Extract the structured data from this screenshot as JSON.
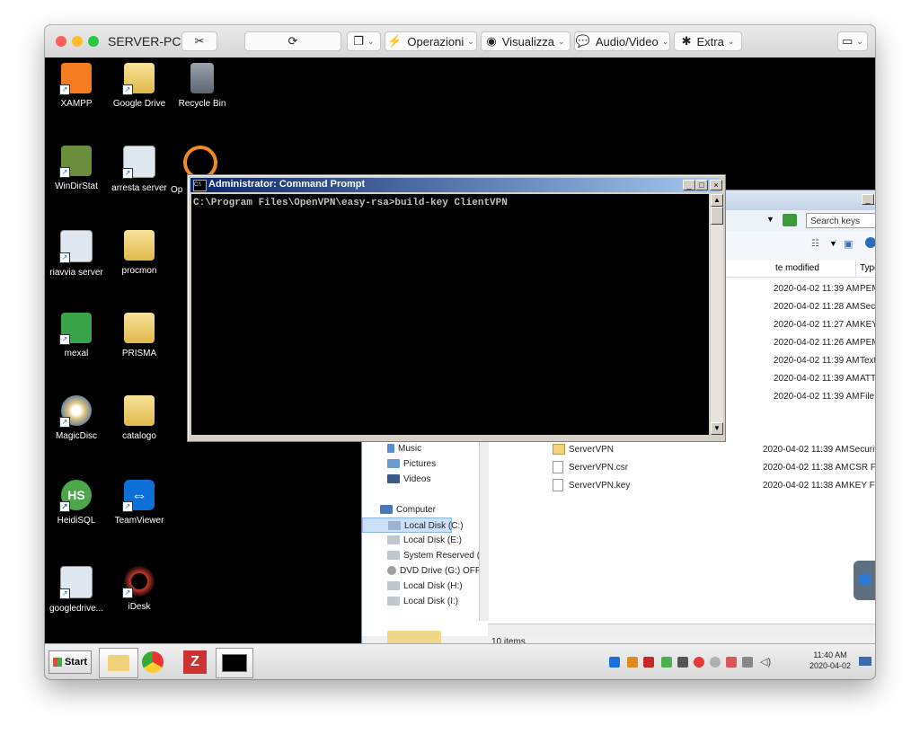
{
  "mac_window": {
    "title": "SERVER-PC",
    "toolbar": {
      "ops_label": "Operazioni",
      "view_label": "Visualizza",
      "av_label": "Audio/Video",
      "extra_label": "Extra"
    }
  },
  "desktop": {
    "icons": [
      {
        "label": "XAMPP"
      },
      {
        "label": "Google Drive"
      },
      {
        "label": "Recycle Bin"
      },
      {
        "label": "WinDirStat"
      },
      {
        "label": "arresta server"
      },
      {
        "label": "Op"
      },
      {
        "label": "riavvia server"
      },
      {
        "label": "procmon"
      },
      {
        "label": "mexal"
      },
      {
        "label": "PRISMA"
      },
      {
        "label": "MagicDisc"
      },
      {
        "label": "catalogo"
      },
      {
        "label": "HeidiSQL"
      },
      {
        "label": "TeamViewer"
      },
      {
        "label": "googledrive..."
      },
      {
        "label": "iDesk"
      }
    ]
  },
  "cmd": {
    "title": "Administrator: Command Prompt",
    "line": "C:\\Program Files\\OpenVPN\\easy-rsa>build-key ClientVPN"
  },
  "explorer": {
    "search_placeholder": "Search keys",
    "col_modified": "te modified",
    "col_type": "Type",
    "rows_hidden": [
      {
        "modified": "2020-04-02 11:39 AM",
        "type": "PEM File"
      },
      {
        "modified": "2020-04-02 11:28 AM",
        "type": "Security Certific"
      },
      {
        "modified": "2020-04-02 11:27 AM",
        "type": "KEY File"
      },
      {
        "modified": "2020-04-02 11:26 AM",
        "type": "PEM File"
      },
      {
        "modified": "2020-04-02 11:39 AM",
        "type": "Text Document"
      },
      {
        "modified": "2020-04-02 11:39 AM",
        "type": "ATTR File"
      },
      {
        "modified": "2020-04-02 11:39 AM",
        "type": "File"
      }
    ],
    "rows_visible": [
      {
        "name": "ServerVPN",
        "modified": "2020-04-02 11:39 AM",
        "type": "Security Certific"
      },
      {
        "name": "ServerVPN.csr",
        "modified": "2020-04-02 11:38 AM",
        "type": "CSR File"
      },
      {
        "name": "ServerVPN.key",
        "modified": "2020-04-02 11:38 AM",
        "type": "KEY File"
      }
    ],
    "nav": [
      {
        "label": "Music"
      },
      {
        "label": "Pictures"
      },
      {
        "label": "Videos"
      },
      {
        "label": "Computer"
      },
      {
        "label": "Local Disk (C:)"
      },
      {
        "label": "Local Disk (E:)"
      },
      {
        "label": "System Reserved ("
      },
      {
        "label": "DVD Drive (G:) OFF"
      },
      {
        "label": "Local Disk (H:)"
      },
      {
        "label": "Local Disk (I:)"
      }
    ],
    "status": "10 items"
  },
  "taskbar": {
    "start_label": "Start",
    "time": "11:40 AM",
    "date": "2020-04-02"
  }
}
